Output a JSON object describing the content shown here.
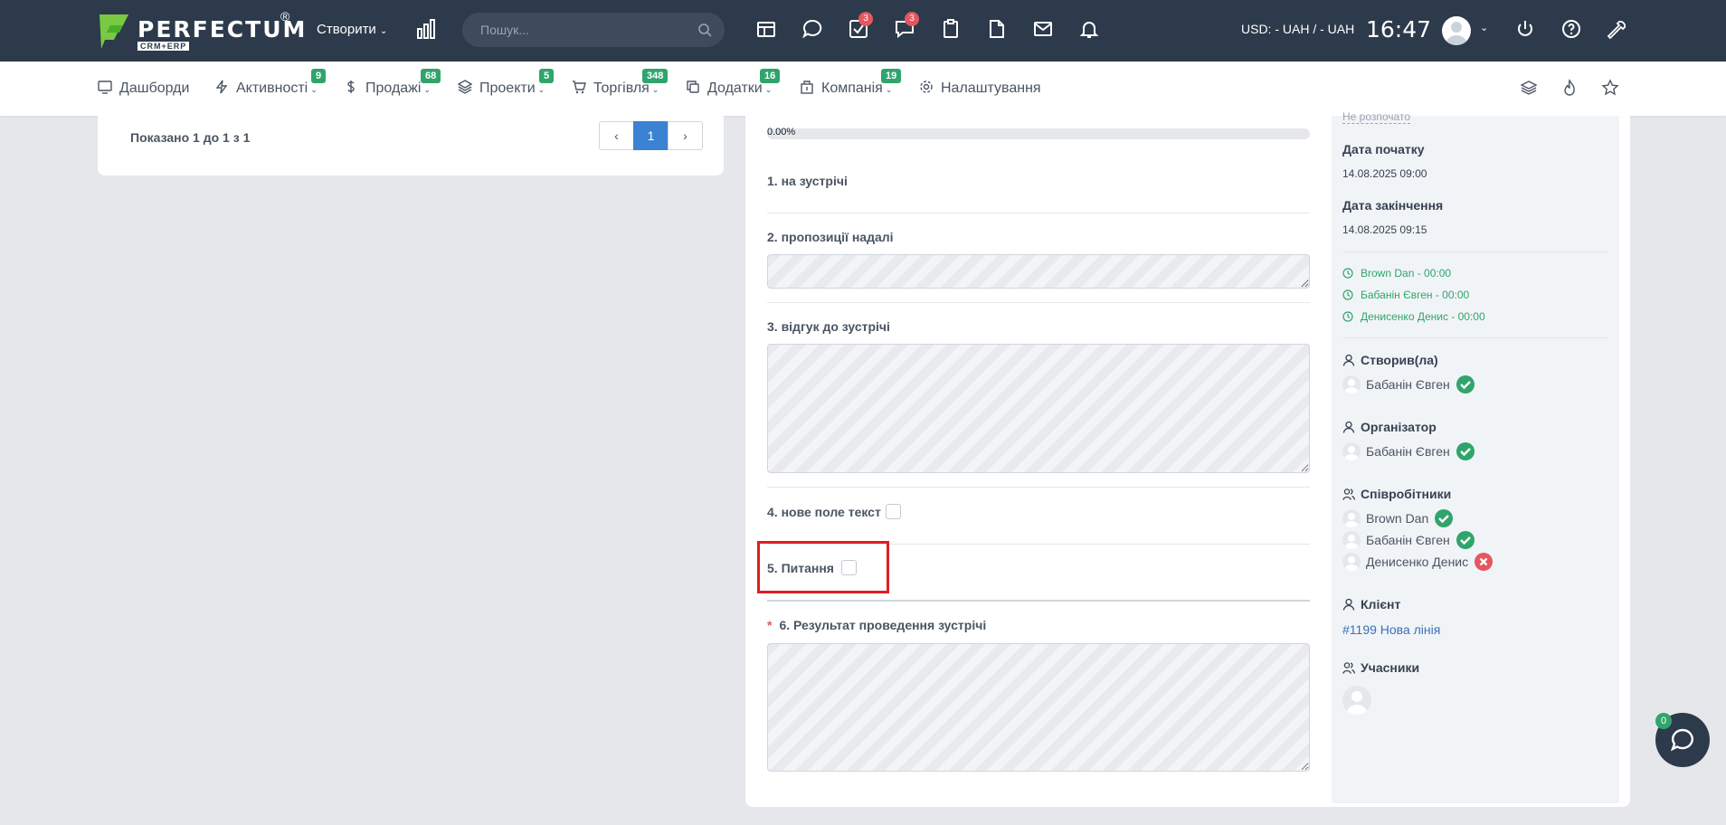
{
  "header": {
    "logo_text": "PERFECTUM",
    "logo_reg": "®",
    "logo_sub": "CRM+ERP",
    "create_label": "Створити",
    "search_placeholder": "Пошук...",
    "tasks_badge": "3",
    "chat_badge": "3",
    "currency": "USD: - UAH / - UAH",
    "time": "16:47"
  },
  "nav": {
    "items": [
      {
        "label": "Дашборди",
        "icon": "dashboard-icon"
      },
      {
        "label": "Активності",
        "icon": "lightning-icon",
        "badge": "9"
      },
      {
        "label": "Продажі",
        "icon": "dollar-icon",
        "badge": "68"
      },
      {
        "label": "Проекти",
        "icon": "layers-icon",
        "badge": "5"
      },
      {
        "label": "Торгівля",
        "icon": "cart-icon",
        "badge": "348"
      },
      {
        "label": "Додатки",
        "icon": "copy-icon",
        "badge": "16"
      },
      {
        "label": "Компанія",
        "icon": "building-icon",
        "badge": "19"
      },
      {
        "label": "Налаштування",
        "icon": "gear-icon"
      }
    ]
  },
  "left": {
    "shown_text": "Показано 1 до 1 з 1",
    "pager": {
      "prev": "‹",
      "current": "1",
      "next": "›"
    }
  },
  "form": {
    "progress": "0.00%",
    "q1": "1. на зустрічі",
    "q2": "2. пропозиції надалі",
    "q3": "3. відгук до зустрічі",
    "q4": "4. нове поле текст",
    "q5": "5. Питання",
    "q6_required": "*",
    "q6": "6. Результат проведення зустрічі"
  },
  "side": {
    "status": "Не розпочато",
    "start_label": "Дата початку",
    "start_value": "14.08.2025 09:00",
    "end_label": "Дата закінчення",
    "end_value": "14.08.2025 09:15",
    "times": [
      "Brown Dan - 00:00",
      "Бабанін Євген - 00:00",
      "Денисенко Денис - 00:00"
    ],
    "creator_label": "Створив(ла)",
    "creator": "Бабанін Євген",
    "organizer_label": "Організатор",
    "organizer": "Бабанін Євген",
    "staff_label": "Співробітники",
    "staff": [
      {
        "name": "Brown Dan",
        "status": "accepted"
      },
      {
        "name": "Бабанін Євген",
        "status": "accepted"
      },
      {
        "name": "Денисенко Денис",
        "status": "declined"
      }
    ],
    "client_label": "Клієнт",
    "client": "#1199 Нова лінія",
    "participants_label": "Учасники"
  },
  "chat": {
    "badge": "0"
  },
  "colors": {
    "topbar": "#2d3a4b",
    "badge_green": "#30a46c",
    "badge_red": "#e45760",
    "accent_blue": "#3b82d4",
    "highlight": "#e11d22"
  }
}
